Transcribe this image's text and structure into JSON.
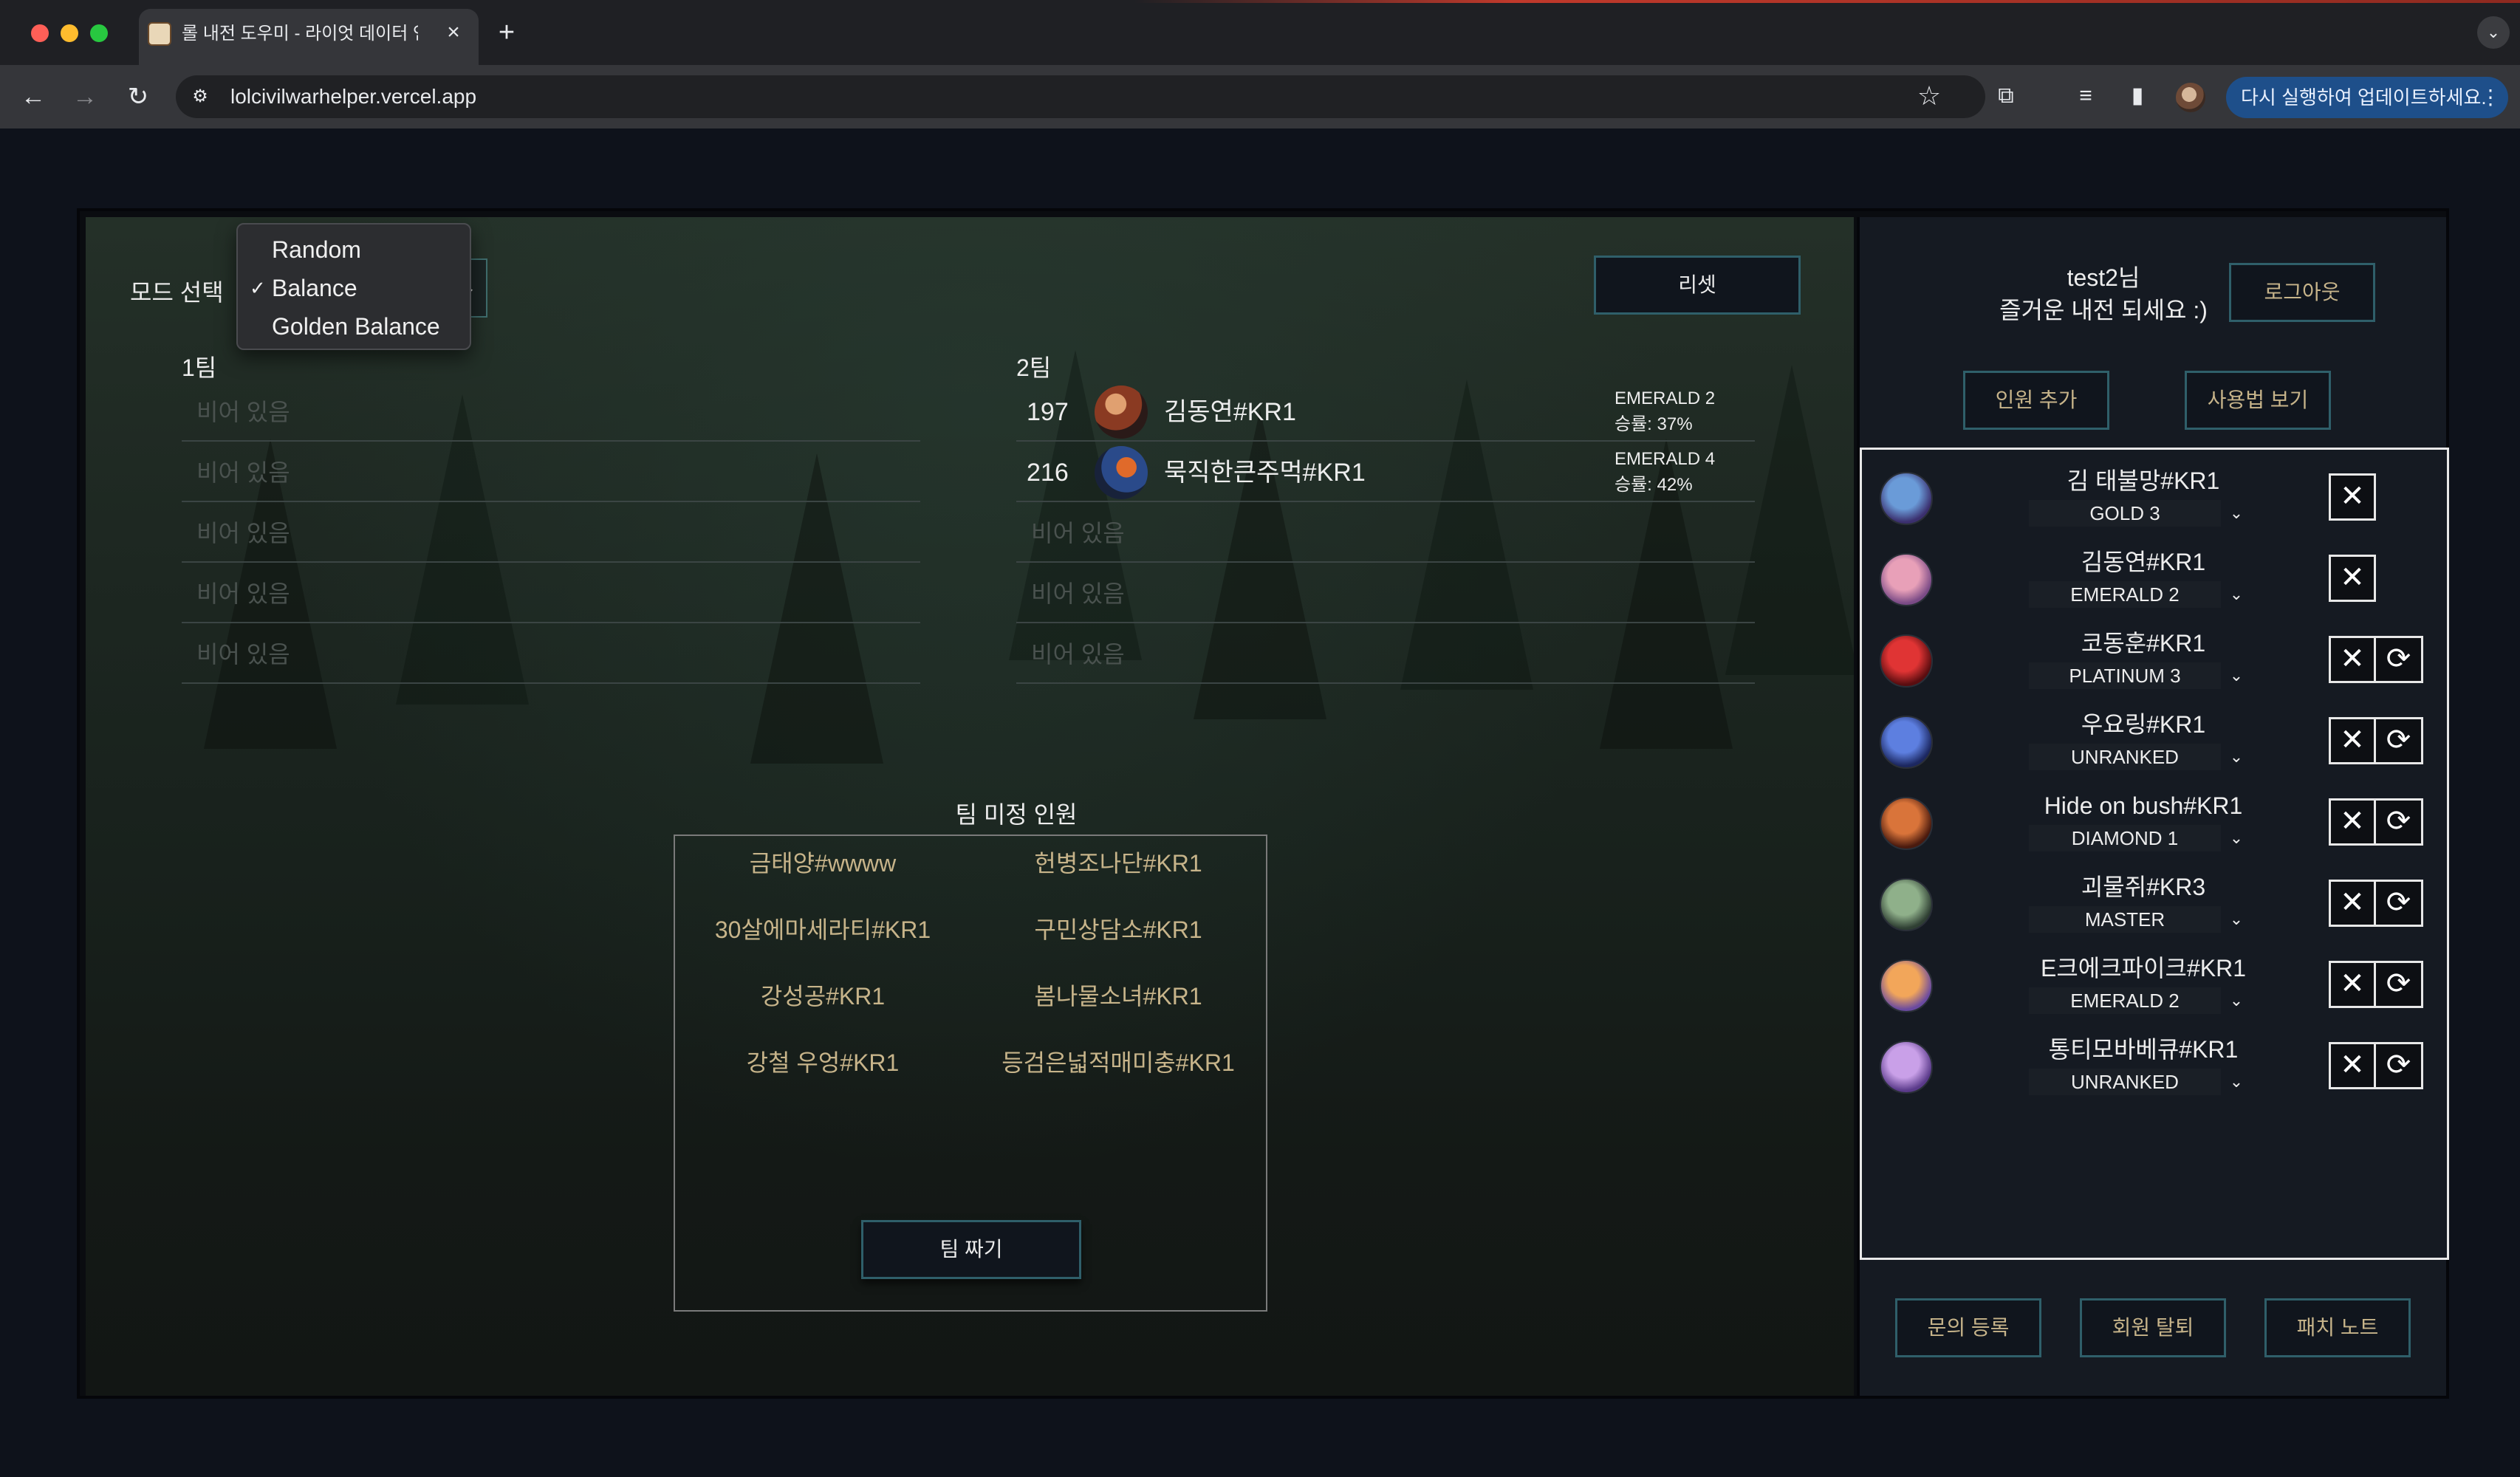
{
  "browser": {
    "tab_title": "롤 내전 도우미 - 라이엇 데이터 연동",
    "tab_close": "×",
    "new_tab": "+",
    "tab_menu": "⌄",
    "url": "lolcivilwarhelper.vercel.app",
    "update_label": "다시 실행하여 업데이트하세요.",
    "update_menu": "⋮",
    "icons": {
      "back": "←",
      "forward": "→",
      "reload": "↻",
      "site": "⚙",
      "star": "☆",
      "extensions": "⧉",
      "reading": "≡",
      "sidepanel": "▮"
    },
    "traffic_colors": [
      "#ff5f57",
      "#febc2e",
      "#28c840"
    ]
  },
  "mode": {
    "label": "모드 선택",
    "caret": "⌄",
    "options": [
      "Random",
      "Balance",
      "Golden Balance"
    ],
    "selected": "Balance",
    "check": "✓"
  },
  "reset_label": "리셋",
  "team1": {
    "label": "1팀",
    "slots": [
      {
        "empty": "비어 있음"
      },
      {
        "empty": "비어 있음"
      },
      {
        "empty": "비어 있음"
      },
      {
        "empty": "비어 있음"
      },
      {
        "empty": "비어 있음"
      }
    ]
  },
  "team2": {
    "label": "2팀",
    "players": [
      {
        "mmr": "197",
        "name": "김동연#KR1",
        "tier": "EMERALD 2",
        "winrate": "승률: 37%"
      },
      {
        "mmr": "216",
        "name": "묵직한큰주먹#KR1",
        "tier": "EMERALD 4",
        "winrate": "승률: 42%"
      }
    ],
    "empty_slots": [
      "비어 있음",
      "비어 있음",
      "비어 있음"
    ]
  },
  "unassigned": {
    "title": "팀 미정 인원",
    "names": [
      "금태양#wwww",
      "헌병조나단#KR1",
      "30살에마세라티#KR1",
      "구민상담소#KR1",
      "강성공#KR1",
      "봄나물소녀#KR1",
      "강철 우엉#KR1",
      "등검은넓적매미충#KR1"
    ],
    "make_team_label": "팀 짜기"
  },
  "user": {
    "greeting_line1": "test2님",
    "greeting_line2": "즐거운 내전 되세요 :)",
    "logout_label": "로그아웃",
    "add_member_label": "인원 추가",
    "howto_label": "사용법 보기"
  },
  "members": [
    {
      "name": "김 태불망#KR1",
      "tier": "GOLD 3",
      "refresh": false,
      "avatar_colors": [
        "#6a9bd8",
        "#3b2f6e"
      ]
    },
    {
      "name": "김동연#KR1",
      "tier": "EMERALD 2",
      "refresh": false,
      "avatar_colors": [
        "#e8a0b8",
        "#7a4a86"
      ]
    },
    {
      "name": "코동훈#KR1",
      "tier": "PLATINUM 3",
      "refresh": true,
      "avatar_colors": [
        "#e03434",
        "#5a0d10"
      ]
    },
    {
      "name": "우요링#KR1",
      "tier": "UNRANKED",
      "refresh": true,
      "avatar_colors": [
        "#5d7fe0",
        "#1c2760"
      ]
    },
    {
      "name": "Hide on bush#KR1",
      "tier": "DIAMOND 1",
      "refresh": true,
      "avatar_colors": [
        "#d9743a",
        "#4a1a0e"
      ]
    },
    {
      "name": "괴물쥐#KR3",
      "tier": "MASTER",
      "refresh": true,
      "avatar_colors": [
        "#8fb08a",
        "#2f3f33"
      ]
    },
    {
      "name": "E크에크파이크#KR1",
      "tier": "EMERALD 2",
      "refresh": true,
      "avatar_colors": [
        "#f2a65a",
        "#6a4aa0"
      ]
    },
    {
      "name": "통티모바베큐#KR1",
      "tier": "UNRANKED",
      "refresh": true,
      "avatar_colors": [
        "#c9a0e8",
        "#5a3a8a"
      ]
    }
  ],
  "member_controls": {
    "remove": "✕",
    "refresh": "⟳",
    "chevron": "⌄"
  },
  "footer_buttons": [
    "문의 등록",
    "회원 탈퇴",
    "패치 노트"
  ]
}
